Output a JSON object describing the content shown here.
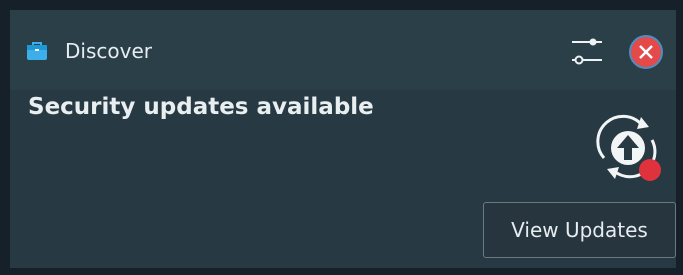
{
  "notification": {
    "app_name": "Discover",
    "title": "Security updates available",
    "action_label": "View Updates"
  },
  "icons": {
    "app": "discover-bag-icon",
    "settings": "sliders-icon",
    "close": "close-icon",
    "updates": "update-arrow-icon"
  },
  "colors": {
    "panel_background": "#273942",
    "header_background": "#2b3f49",
    "close_red": "#e54a4a",
    "app_icon_blue": "#3daee9",
    "badge_red": "#e0323c"
  }
}
